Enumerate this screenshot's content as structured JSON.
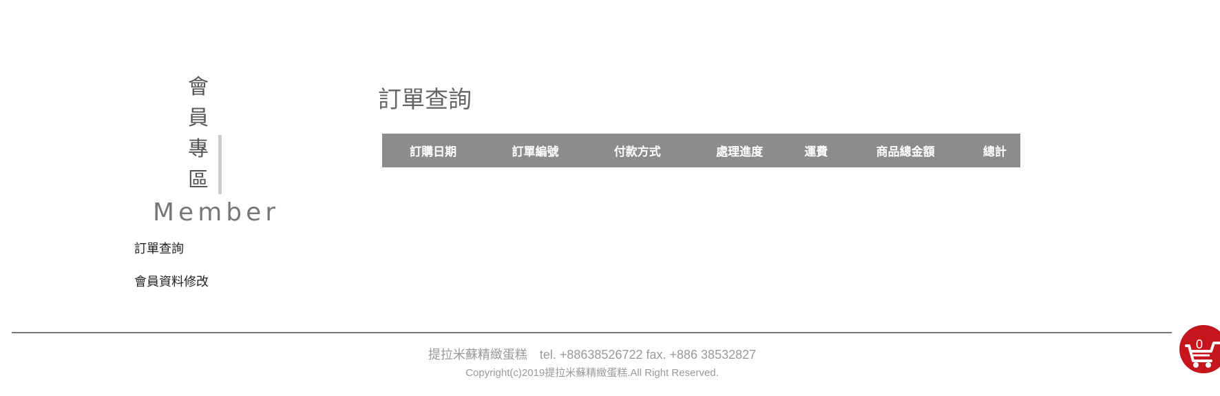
{
  "sidebar": {
    "title_cn_chars": [
      "會",
      "員",
      "專",
      "區"
    ],
    "title_en": "Member",
    "items": [
      {
        "label": "訂單查詢"
      },
      {
        "label": "會員資料修改"
      }
    ]
  },
  "main": {
    "title": "訂單查詢",
    "table": {
      "columns": [
        "訂購日期",
        "訂單編號",
        "付款方式",
        "處理進度",
        "運費",
        "商品總金額",
        "總計"
      ],
      "rows": []
    }
  },
  "footer": {
    "company": "提拉米蘇精緻蛋糕",
    "contact": "tel. +88638526722 fax. +886 38532827",
    "copyright": "Copyright(c)2019提拉米蘇精緻蛋糕.All Right Reserved."
  },
  "cart": {
    "count": "0",
    "icon": "cart-icon",
    "color": "#c4161c"
  },
  "colors": {
    "table_header_bg": "#8c8c8c",
    "title_text": "#666666"
  }
}
